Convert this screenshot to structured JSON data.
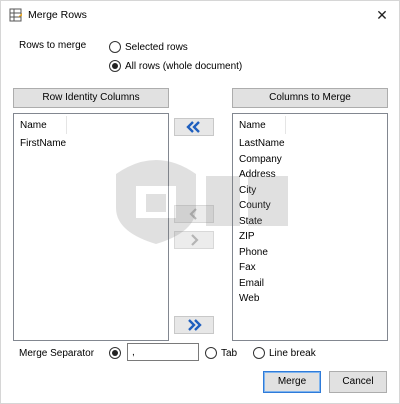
{
  "window": {
    "title": "Merge Rows",
    "close_symbol": "✕"
  },
  "rows_to_merge": {
    "label": "Rows to merge",
    "options": [
      {
        "label": "Selected rows",
        "checked": false
      },
      {
        "label": "All rows (whole document)",
        "checked": true
      }
    ]
  },
  "row_identity": {
    "button_label": "Row Identity Columns",
    "header": "Name",
    "items": [
      "FirstName"
    ]
  },
  "columns_to_merge": {
    "button_label": "Columns to Merge",
    "header": "Name",
    "items": [
      "LastName",
      "Company",
      "Address",
      "City",
      "County",
      "State",
      "ZIP",
      "Phone",
      "Fax",
      "Email",
      "Web"
    ]
  },
  "transfer_buttons": [
    {
      "icon": "double-chevron-left-icon",
      "enabled": true
    },
    {
      "icon": "chevron-left-icon",
      "enabled": false
    },
    {
      "icon": "chevron-right-icon",
      "enabled": false
    },
    {
      "icon": "double-chevron-right-icon",
      "enabled": true
    }
  ],
  "merge_separator": {
    "label": "Merge Separator",
    "options": [
      {
        "label": "",
        "value": ",",
        "checked": true
      },
      {
        "label": "Tab",
        "checked": false
      },
      {
        "label": "Line break",
        "checked": false
      }
    ]
  },
  "buttons": {
    "merge": "Merge",
    "cancel": "Cancel"
  },
  "colors": {
    "accent": "#2f7bd9",
    "arrow_blue": "#1f5fbf"
  }
}
